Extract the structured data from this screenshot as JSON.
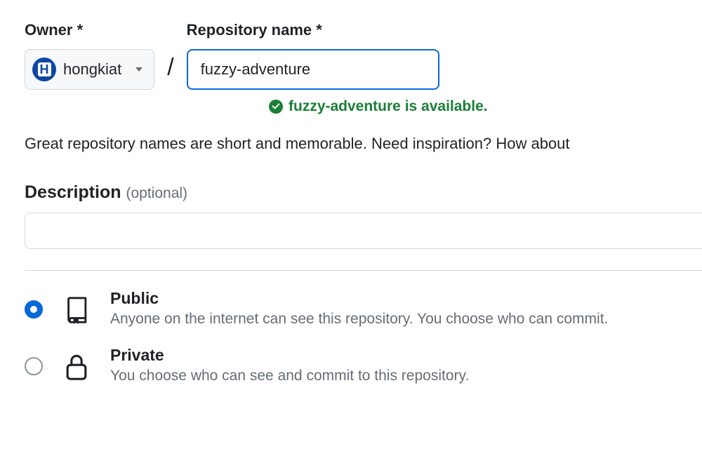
{
  "owner": {
    "label": "Owner *",
    "name": "hongkiat",
    "avatarLetter": "H"
  },
  "repo": {
    "label": "Repository name *",
    "value": "fuzzy-adventure",
    "availability": "fuzzy-adventure is available."
  },
  "hint": "Great repository names are short and memorable. Need inspiration? How about",
  "description": {
    "label": "Description",
    "optional": "(optional)",
    "value": ""
  },
  "visibility": {
    "public": {
      "title": "Public",
      "desc": "Anyone on the internet can see this repository. You choose who can commit."
    },
    "private": {
      "title": "Private",
      "desc": "You choose who can see and commit to this repository."
    }
  }
}
